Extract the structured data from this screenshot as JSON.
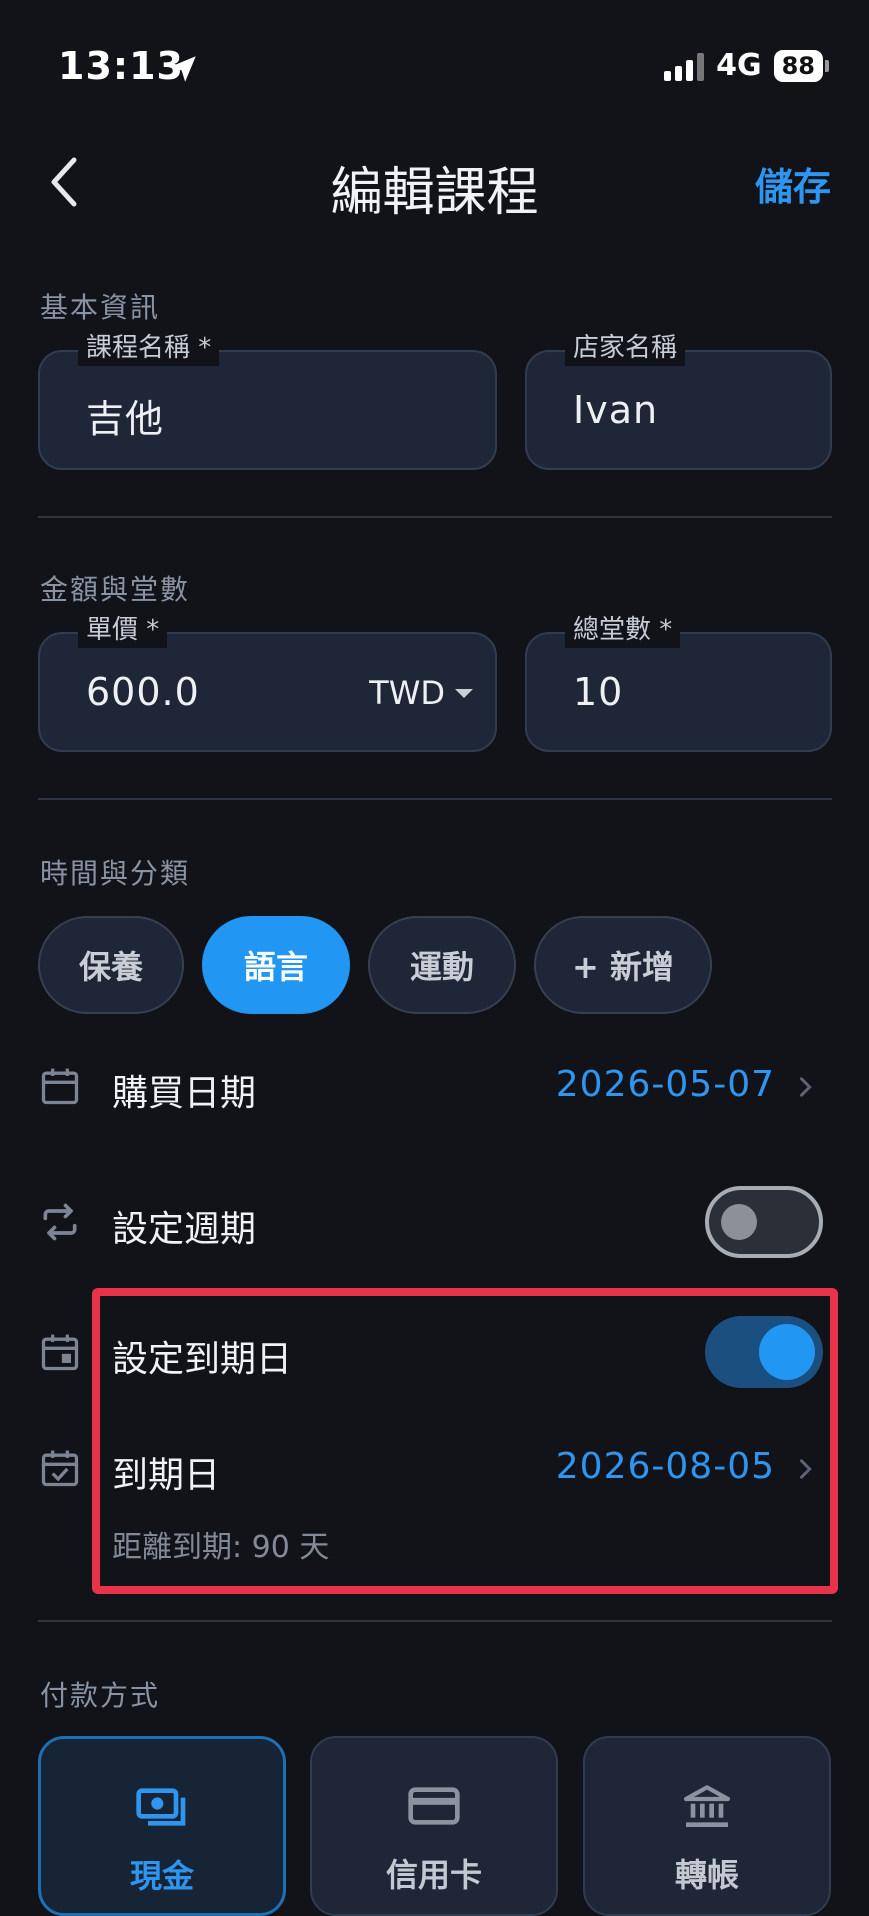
{
  "status": {
    "time": "13:13",
    "network": "4G",
    "battery": "88"
  },
  "nav": {
    "title": "編輯課程",
    "save": "儲存"
  },
  "basic": {
    "section": "基本資訊",
    "course_label": "課程名稱 *",
    "course_value": "吉他",
    "store_label": "店家名稱",
    "store_value": "Ivan"
  },
  "amount": {
    "section": "金額與堂數",
    "price_label": "單價 *",
    "price_value": "600.0",
    "currency": "TWD",
    "count_label": "總堂數 *",
    "count_value": "10"
  },
  "time": {
    "section": "時間與分類",
    "categories": [
      {
        "label": "保養",
        "active": false
      },
      {
        "label": "語言",
        "active": true
      },
      {
        "label": "運動",
        "active": false
      },
      {
        "label": "+ 新增",
        "active": false
      }
    ],
    "purchase_label": "購買日期",
    "purchase_value": "2026-05-07",
    "recurring_label": "設定週期",
    "recurring_on": false,
    "due_toggle_label": "設定到期日",
    "due_toggle_on": true,
    "due_label": "到期日",
    "due_value": "2026-08-05",
    "due_hint": "距離到期: 90 天"
  },
  "payment": {
    "section": "付款方式",
    "methods": [
      {
        "label": "現金",
        "icon": "cash-icon",
        "active": true
      },
      {
        "label": "信用卡",
        "icon": "credit-card-icon",
        "active": false
      },
      {
        "label": "轉帳",
        "icon": "bank-icon",
        "active": false
      }
    ]
  },
  "colors": {
    "accent": "#2296f3",
    "highlight": "#e8334a",
    "background": "#111318"
  }
}
